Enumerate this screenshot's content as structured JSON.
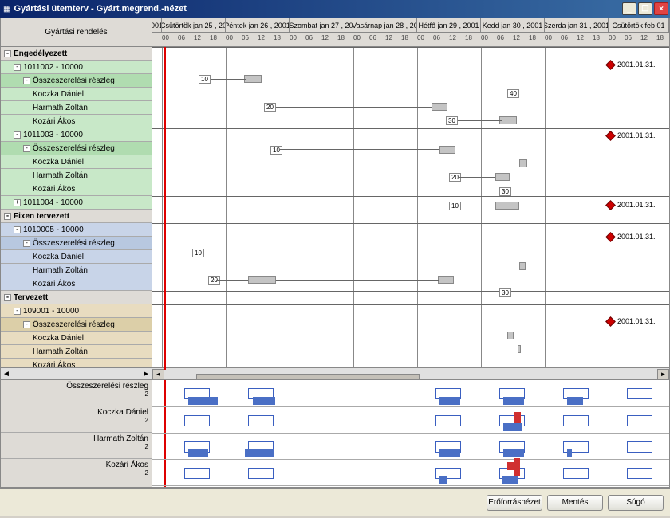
{
  "title": "Gyártási ütemterv - Gyárt.megrend.-nézet",
  "left_header": "Gyártási rendelés",
  "groups": [
    {
      "label": "Engedélyezett",
      "class": "header-row",
      "expander": "-"
    },
    {
      "label": "1011002 - 10000",
      "class": "green",
      "expander": "-",
      "indent": 1
    },
    {
      "label": "Összeszerelési részleg",
      "class": "green-dark",
      "expander": "-",
      "indent": 2
    },
    {
      "label": "Koczka Dániel",
      "class": "green",
      "indent": 3
    },
    {
      "label": "Harmath Zoltán",
      "class": "green",
      "indent": 3
    },
    {
      "label": "Kozári Ákos",
      "class": "green",
      "indent": 3
    },
    {
      "label": "1011003 - 10000",
      "class": "green",
      "expander": "-",
      "indent": 1
    },
    {
      "label": "Összeszerelési részleg",
      "class": "green-dark",
      "expander": "-",
      "indent": 2
    },
    {
      "label": "Koczka Dániel",
      "class": "green",
      "indent": 3
    },
    {
      "label": "Harmath Zoltán",
      "class": "green",
      "indent": 3
    },
    {
      "label": "Kozári Ákos",
      "class": "green",
      "indent": 3
    },
    {
      "label": "1011004 - 10000",
      "class": "green",
      "expander": "+",
      "indent": 1
    },
    {
      "label": "Fixen tervezett",
      "class": "header-row",
      "expander": "-"
    },
    {
      "label": "1010005 - 10000",
      "class": "blue",
      "expander": "-",
      "indent": 1
    },
    {
      "label": "Összeszerelési részleg",
      "class": "blue-dark",
      "expander": "-",
      "indent": 2
    },
    {
      "label": "Koczka Dániel",
      "class": "blue",
      "indent": 3
    },
    {
      "label": "Harmath Zoltán",
      "class": "blue",
      "indent": 3
    },
    {
      "label": "Kozári Ákos",
      "class": "blue",
      "indent": 3
    },
    {
      "label": "Tervezett",
      "class": "header-row",
      "expander": "-"
    },
    {
      "label": "109001 - 10000",
      "class": "tan",
      "expander": "-",
      "indent": 1
    },
    {
      "label": "Összeszerelési részleg",
      "class": "tan-dark",
      "expander": "-",
      "indent": 2
    },
    {
      "label": "Koczka Dániel",
      "class": "tan",
      "indent": 3
    },
    {
      "label": "Harmath Zoltán",
      "class": "tan",
      "indent": 3
    },
    {
      "label": "Kozári Ákos",
      "class": "tan",
      "indent": 3
    }
  ],
  "days": [
    "001",
    "Csütörtök jan 25 , 20",
    "Péntek jan 26 , 2001",
    "Szombat jan 27 , 20",
    "Vasárnap jan 28 , 20",
    "Hétfő jan 29 , 2001",
    "Kedd jan 30 , 2001",
    "Szerda jan 31 , 2001",
    "Csütörtök feb 01"
  ],
  "hours": [
    "00",
    "06",
    "12",
    "18"
  ],
  "milestones_label": "2001.01.31.",
  "bottom_rows": [
    "Összeszerelési részleg",
    "Koczka Dániel",
    "Harmath Zoltán",
    "Kozári Ákos"
  ],
  "bottom_tick": "2",
  "buttons": {
    "resource": "Erőforrásnézet",
    "save": "Mentés",
    "help": "Súgó"
  },
  "tasklabels": {
    "t10": "10",
    "t20": "20",
    "t30": "30",
    "t40": "40"
  }
}
